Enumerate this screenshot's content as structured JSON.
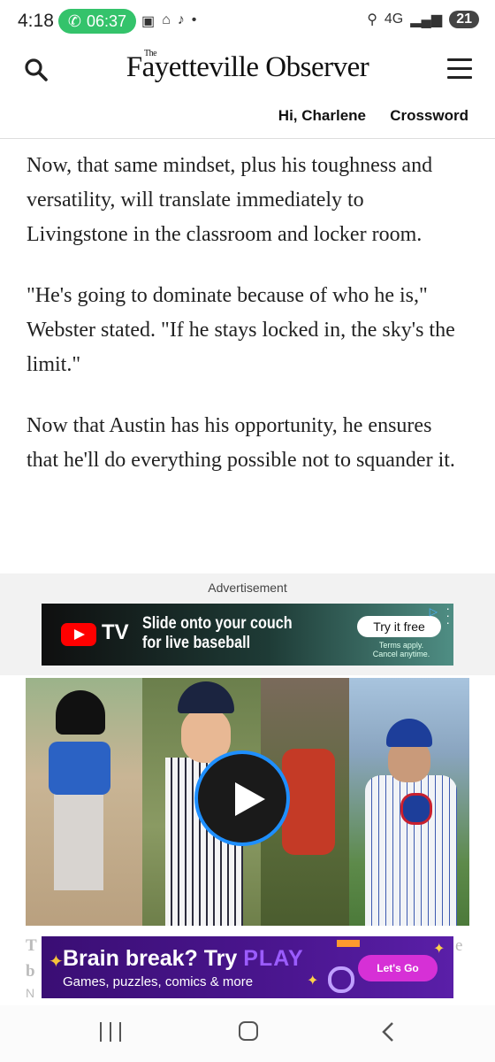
{
  "status_bar": {
    "time": "4:18",
    "call_timer": "06:37",
    "network": "4G",
    "battery": "21",
    "icons": [
      "screenshot-icon",
      "google-home-icon",
      "tiktok-icon",
      "dot-icon",
      "location-icon",
      "signal-icon"
    ]
  },
  "header": {
    "logo_the": "The",
    "logo": "Fayetteville Observer",
    "greeting": "Hi, Charlene",
    "crossword": "Crossword"
  },
  "article": {
    "paragraphs": [
      "Now, that same mindset, plus his toughness and versatility, will translate immediately to Livingstone in the classroom and locker room.",
      "\"He's going to dominate because of who he is,\" Webster stated. \"If he stays locked in, the sky's the limit.\"",
      "Now that Austin has his opportunity, he ensures that he'll do everything possible not to squander it."
    ]
  },
  "advertisement": {
    "label": "Advertisement",
    "brand": "TV",
    "headline_line1": "Slide onto your couch",
    "headline_line2": "for live baseball",
    "cta": "Try it free",
    "terms_line1": "Terms apply.",
    "terms_line2": "Cancel anytime.",
    "colors": {
      "youtube_red": "#ff0000"
    }
  },
  "video": {
    "caption_fragment_1": "T",
    "caption_fragment_2": "b",
    "caption_fragment_3": "e",
    "caption_fragment_4": "N"
  },
  "play_ad": {
    "headline_prefix": "Brain break? Try ",
    "headline_play": "PLAY",
    "subline": "Games, puzzles, comics & more",
    "cta": "Let's Go"
  },
  "nav_bar": {
    "icons": [
      "recent-apps-icon",
      "home-icon",
      "back-icon"
    ]
  }
}
